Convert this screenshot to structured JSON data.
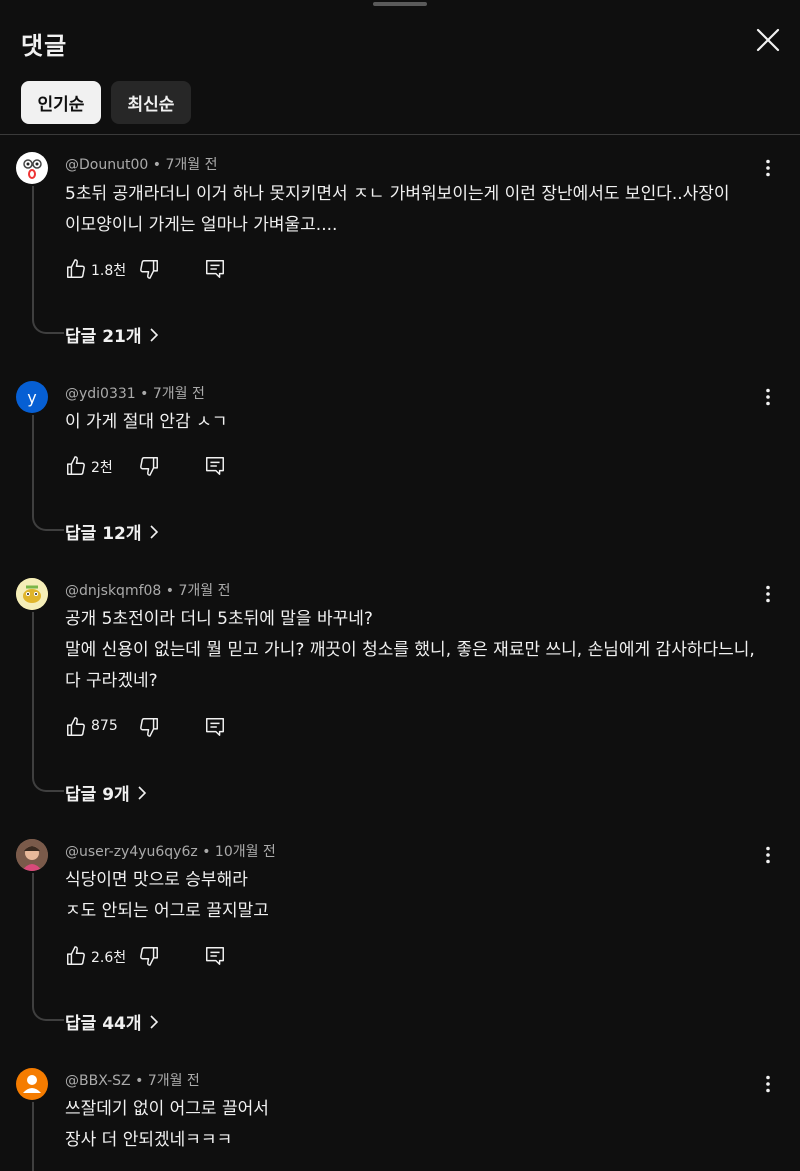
{
  "header": {
    "title": "댓글"
  },
  "sort": {
    "popular": "인기순",
    "newest": "최신순"
  },
  "comments": [
    {
      "handle": "@Dounut00",
      "time": "7개월 전",
      "lines": [
        "5초뒤 공개라더니 이거 하나 못지키면서 ㅈㄴ 가벼워보이는게 이런 장난에서도 보인다..사장이",
        "이모양이니 가게는 얼마나 가벼울고...."
      ],
      "likes": "1.8천",
      "replies": "답글 21개"
    },
    {
      "handle": "@ydi0331",
      "time": "7개월 전",
      "avatar_letter": "y",
      "lines": [
        "이 가게 절대 안감 ㅅㄱ"
      ],
      "likes": "2천",
      "replies": "답글 12개"
    },
    {
      "handle": "@dnjskqmf08",
      "time": "7개월 전",
      "lines": [
        "공개 5초전이라 더니 5초뒤에 말을 바꾸네?",
        "말에 신용이 없는데 뭘 믿고 가니? 깨끗이 청소를 했니, 좋은 재료만 쓰니, 손님에게 감사하다느니,",
        "다 구라겠네?"
      ],
      "likes": "875",
      "replies": "답글 9개"
    },
    {
      "handle": "@user-zy4yu6qy6z",
      "time": "10개월 전",
      "lines": [
        "식당이면 맛으로 승부해라",
        "ㅈ도 안되는 어그로 끌지말고"
      ],
      "likes": "2.6천",
      "replies": "답글 44개"
    },
    {
      "handle": "@BBX-SZ",
      "time": "7개월 전",
      "lines": [
        "쓰잘데기 없이 어그로 끌어서",
        "장사 더 안되겠네ㅋㅋㅋ"
      ]
    }
  ],
  "colors": {
    "background": "#0f0f0f",
    "text": "#f1f1f1",
    "secondary": "#aaaaaa",
    "chip_active": "#f1f1f1",
    "chip_inactive": "#272727",
    "avatar_ydi": "#065fd4",
    "avatar_bbx": "#f57c00"
  }
}
